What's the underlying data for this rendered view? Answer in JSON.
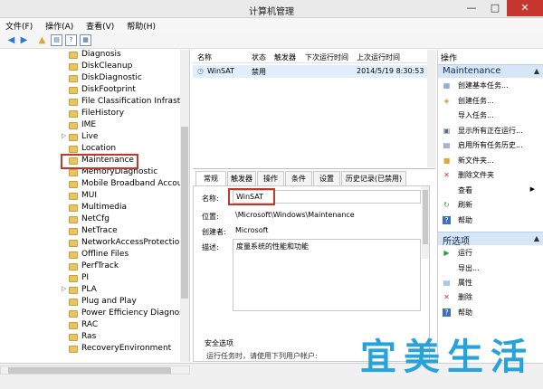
{
  "window": {
    "title": "计算机管理",
    "controls": {
      "minimize": "—",
      "maximize": "□",
      "close": "✕"
    }
  },
  "menu": [
    "文件(F)",
    "操作(A)",
    "查看(V)",
    "帮助(H)"
  ],
  "tree": {
    "items": [
      {
        "label": "Diagnosis"
      },
      {
        "label": "DiskCleanup"
      },
      {
        "label": "DiskDiagnostic"
      },
      {
        "label": "DiskFootprint"
      },
      {
        "label": "File Classification Infrastruc"
      },
      {
        "label": "FileHistory"
      },
      {
        "label": "IME"
      },
      {
        "label": "Live",
        "expandable": true
      },
      {
        "label": "Location"
      },
      {
        "label": "Maintenance",
        "selected": true
      },
      {
        "label": "MemoryDiagnostic"
      },
      {
        "label": "Mobile Broadband Accour"
      },
      {
        "label": "MUI"
      },
      {
        "label": "Multimedia"
      },
      {
        "label": "NetCfg"
      },
      {
        "label": "NetTrace"
      },
      {
        "label": "NetworkAccessProtection"
      },
      {
        "label": "Offline Files"
      },
      {
        "label": "PerfTrack"
      },
      {
        "label": "PI"
      },
      {
        "label": "PLA",
        "expandable": true
      },
      {
        "label": "Plug and Play"
      },
      {
        "label": "Power Efficiency Diagnosti"
      },
      {
        "label": "RAC"
      },
      {
        "label": "Ras"
      },
      {
        "label": "RecoveryEnvironment"
      }
    ]
  },
  "tasklist": {
    "columns": [
      "名称",
      "状态",
      "触发器",
      "下次运行时间",
      "上次运行时间"
    ],
    "row": {
      "name": "WinSAT",
      "status": "禁用",
      "last_run": "2014/5/19 8:30:53"
    }
  },
  "tabs": [
    "常规",
    "触发器",
    "操作",
    "条件",
    "设置",
    "历史记录(已禁用)"
  ],
  "detail": {
    "name_label": "名称:",
    "name_value": "WinSAT",
    "location_label": "位置:",
    "location_value": "\\Microsoft\\Windows\\Maintenance",
    "author_label": "创建者:",
    "author_value": "Microsoft",
    "desc_label": "描述:",
    "desc_value": "度量系统的性能和功能",
    "security_title": "安全选项",
    "security_text": "运行任务时，请使用下列用户帐户:"
  },
  "actions": {
    "header": "操作",
    "group1": {
      "title": "Maintenance",
      "items": [
        {
          "label": "创建基本任务..."
        },
        {
          "label": "创建任务..."
        },
        {
          "label": "导入任务..."
        },
        {
          "label": "显示所有正在运行..."
        },
        {
          "label": "启用所有任务历史..."
        },
        {
          "label": "新文件夹..."
        },
        {
          "label": "删除文件夹"
        },
        {
          "label": "查看",
          "submenu": true
        },
        {
          "label": "刷新"
        },
        {
          "label": "帮助"
        }
      ]
    },
    "group2": {
      "title": "所选项",
      "items": [
        {
          "label": "运行"
        },
        {
          "label": "导出..."
        },
        {
          "label": "属性"
        },
        {
          "label": "删除"
        },
        {
          "label": "帮助"
        }
      ]
    }
  },
  "watermark": [
    "宜",
    "美",
    "生",
    "活"
  ],
  "colors": {
    "accent_blue": "#28a3d9",
    "highlight_red": "#c0392b",
    "section_bg": "#d6e6f7",
    "selected_row": "#e3eefc"
  }
}
